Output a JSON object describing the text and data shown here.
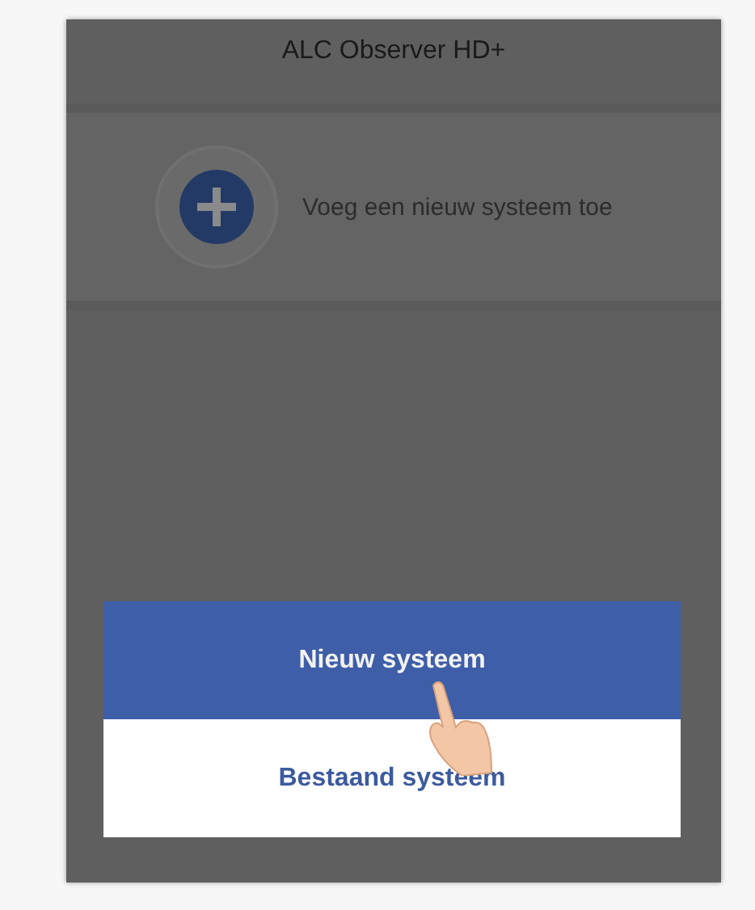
{
  "app_bar": {
    "title": "ALC Observer HD+"
  },
  "add_item": {
    "label": "Voeg een nieuw systeem toe"
  },
  "sheet": {
    "options": [
      {
        "label": "Nieuw systeem",
        "selected": true
      },
      {
        "label": "Bestaand systeem",
        "selected": false
      }
    ]
  }
}
